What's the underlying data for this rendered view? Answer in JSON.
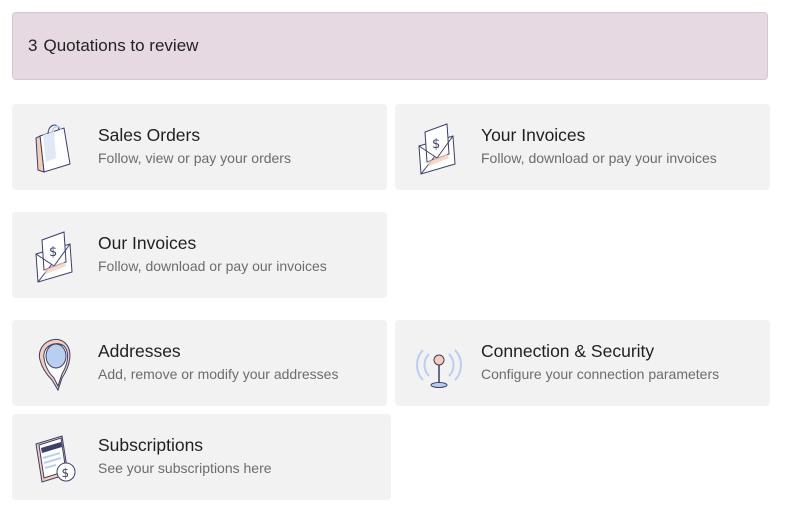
{
  "alert": {
    "count": "3",
    "label": "Quotations to review"
  },
  "cards": [
    {
      "title": "Sales Orders",
      "desc": "Follow, view or pay your orders",
      "icon": "shopping-bag-icon"
    },
    {
      "title": "Your Invoices",
      "desc": "Follow, download or pay your invoices",
      "icon": "invoice-envelope-icon"
    },
    {
      "title": "Our Invoices",
      "desc": "Follow, download or pay our invoices",
      "icon": "invoice-envelope-icon"
    },
    {
      "title": "Addresses",
      "desc": "Add, remove or modify your addresses",
      "icon": "map-pin-icon"
    },
    {
      "title": "Connection & Security",
      "desc": "Configure your connection parameters",
      "icon": "antenna-icon"
    },
    {
      "title": "Subscriptions",
      "desc": "See your subscriptions here",
      "icon": "subscription-document-icon"
    }
  ],
  "colors": {
    "alert_bg": "#e6d9e2",
    "card_bg": "#f2f2f2",
    "icon_stroke": "#3a3f6b",
    "icon_peach": "#f6cdb9",
    "icon_blue": "#b9cff0"
  }
}
